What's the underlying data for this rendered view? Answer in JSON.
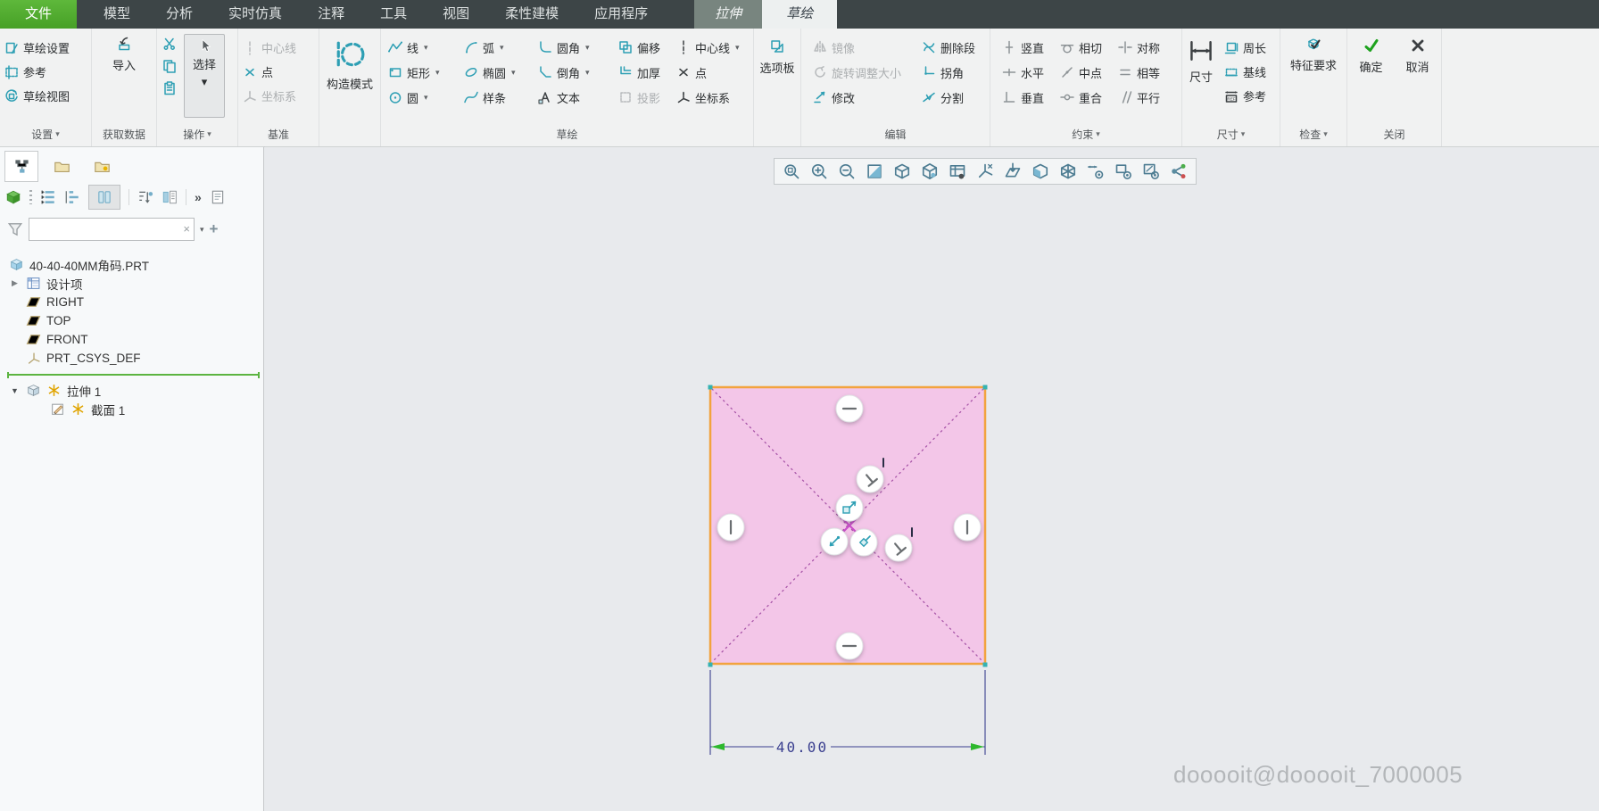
{
  "glyphs": {
    "menu_arrow": "▾",
    "clear": "×",
    "overflow": "»",
    "collapsed": "▶",
    "expanded": "▼",
    "add": "+"
  },
  "tabbar": {
    "tabs": [
      {
        "label": "文件"
      },
      {
        "label": "模型"
      },
      {
        "label": "分析"
      },
      {
        "label": "实时仿真"
      },
      {
        "label": "注释"
      },
      {
        "label": "工具"
      },
      {
        "label": "视图"
      },
      {
        "label": "柔性建模"
      },
      {
        "label": "应用程序"
      },
      {
        "label": "拉伸"
      },
      {
        "label": "草绘"
      }
    ]
  },
  "ribbon": {
    "groups": {
      "settings": {
        "label": "设置",
        "buttons": [
          {
            "label": "草绘设置"
          },
          {
            "label": "参考"
          },
          {
            "label": "草绘视图"
          }
        ]
      },
      "getdata": {
        "label": "获取数据",
        "import_label": "导入"
      },
      "operations": {
        "label": "操作",
        "select_label": "选择"
      },
      "datum": {
        "label": "基准",
        "buttons": [
          {
            "label": "中心线"
          },
          {
            "label": "点"
          },
          {
            "label": "坐标系"
          }
        ]
      },
      "construction": {
        "label": "构造模式"
      },
      "sketch": {
        "label": "草绘",
        "buttons": [
          {
            "label": "线"
          },
          {
            "label": "矩形"
          },
          {
            "label": "圆"
          },
          {
            "label": "弧"
          },
          {
            "label": "椭圆"
          },
          {
            "label": "样条"
          },
          {
            "label": "圆角"
          },
          {
            "label": "倒角"
          },
          {
            "label": "文本"
          },
          {
            "label": "偏移"
          },
          {
            "label": "加厚"
          },
          {
            "label": "投影"
          },
          {
            "label": "中心线"
          },
          {
            "label": "点"
          },
          {
            "label": "坐标系"
          }
        ]
      },
      "palette": {
        "label": "选项板"
      },
      "edit": {
        "label": "编辑",
        "buttons": [
          {
            "label": "镜像"
          },
          {
            "label": "旋转调整大小"
          },
          {
            "label": "修改"
          },
          {
            "label": "删除段"
          },
          {
            "label": "拐角"
          },
          {
            "label": "分割"
          }
        ]
      },
      "constrain": {
        "label": "约束",
        "buttons": [
          {
            "label": "竖直"
          },
          {
            "label": "水平"
          },
          {
            "label": "垂直"
          },
          {
            "label": "相切"
          },
          {
            "label": "中点"
          },
          {
            "label": "重合"
          },
          {
            "label": "对称"
          },
          {
            "label": "相等"
          },
          {
            "label": "平行"
          }
        ]
      },
      "dimension": {
        "label": "尺寸",
        "main_label": "尺寸",
        "buttons": [
          {
            "label": "周长"
          },
          {
            "label": "基线"
          },
          {
            "label": "参考"
          }
        ]
      },
      "inspect": {
        "label": "检查",
        "main_label": "特征要求"
      },
      "close": {
        "label": "关闭",
        "ok_label": "确定",
        "cancel_label": "取消"
      }
    }
  },
  "navigator": {
    "search_value": "",
    "model_tree": [
      {
        "label": "40-40-40MM角码.PRT"
      },
      {
        "label": "设计项"
      },
      {
        "label": "RIGHT"
      },
      {
        "label": "TOP"
      },
      {
        "label": "FRONT"
      },
      {
        "label": "PRT_CSYS_DEF"
      },
      {
        "label": "拉伸 1"
      },
      {
        "label": "截面 1"
      }
    ]
  },
  "canvas": {
    "dimension_value": "40.00",
    "watermark": "dooooit@dooooit_7000005"
  },
  "colors": {
    "accent_green": "#4da02f",
    "icon_teal": "#2e9fb4",
    "sketch_fill": "#f3c6e8",
    "sketch_border": "#f2a33e",
    "construction_line": "#a855a8",
    "dimension_text": "#3a3f8f",
    "arrow_green": "#2db82d",
    "modified_star": "#e0a400"
  }
}
